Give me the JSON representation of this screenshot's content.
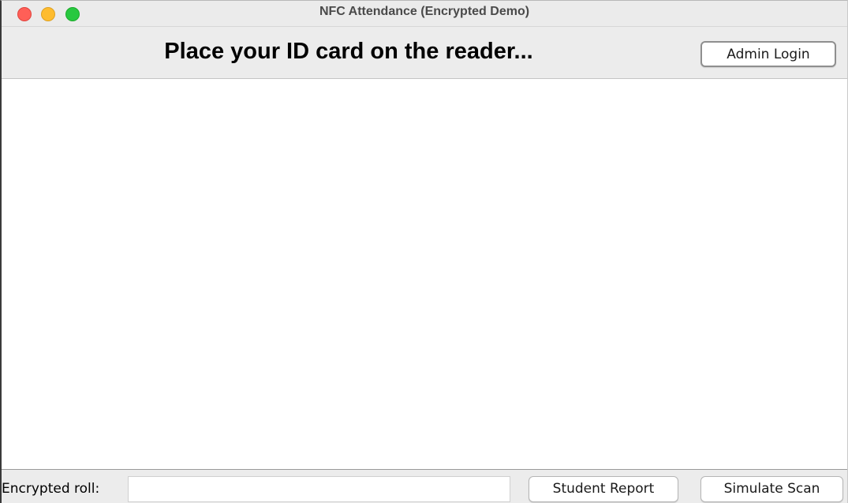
{
  "window": {
    "title": "NFC Attendance (Encrypted Demo)",
    "controls": [
      "close",
      "minimize",
      "maximize"
    ]
  },
  "header": {
    "prompt": "Place your ID card on the reader...",
    "admin_login_label": "Admin Login"
  },
  "footer": {
    "roll_label": "Encrypted roll:",
    "roll_value": "",
    "student_report_label": "Student Report",
    "simulate_scan_label": "Simulate Scan"
  },
  "colors": {
    "close": "#ff5f57",
    "minimize": "#febc2e",
    "maximize": "#28c840"
  }
}
